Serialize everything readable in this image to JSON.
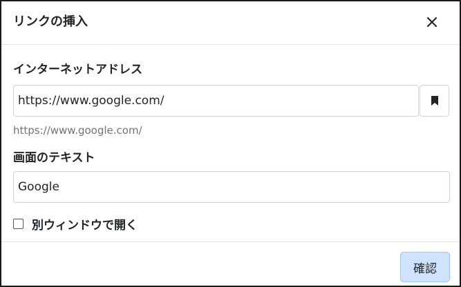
{
  "dialog": {
    "title": "リンクの挿入",
    "close_icon": "close-icon"
  },
  "url_section": {
    "label": "インターネットアドレス",
    "value": "https://www.google.com/",
    "preview": "https://www.google.com/",
    "bookmark_icon": "bookmark-icon"
  },
  "text_section": {
    "label": "画面のテキスト",
    "value": "Google"
  },
  "new_window": {
    "label": "別ウィンドウで開く",
    "checked": false
  },
  "footer": {
    "confirm_label": "確認"
  },
  "colors": {
    "confirm_bg": "#cfe2ff",
    "border": "#ced4da",
    "preview_text": "#6c757d"
  }
}
